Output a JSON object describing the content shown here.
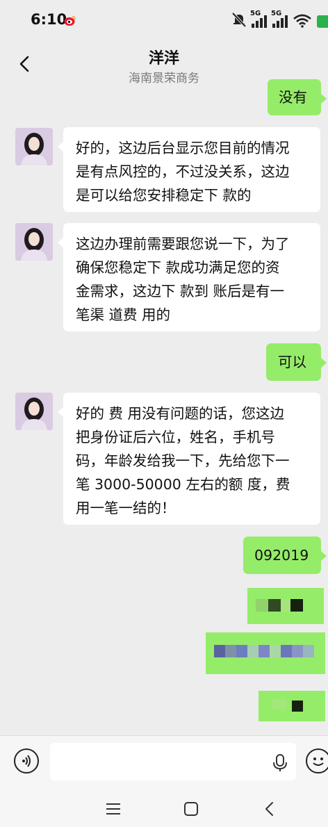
{
  "status": {
    "time": "6:10",
    "sim1_label": "5G",
    "sim2_label": "5G"
  },
  "header": {
    "title": "洋洋",
    "subtitle": "海南景荣商务"
  },
  "messages": [
    {
      "side": "out",
      "text": "没有"
    },
    {
      "side": "in",
      "lines": [
        "好的，这边后台显示您目前的情况",
        "是有点风控的，不过没关系，这边",
        "是可以给您安排稳定下 款的"
      ]
    },
    {
      "side": "in",
      "lines": [
        "这边办理前需要跟您说一下，为了",
        "确保您稳定下 款成功满足您的资",
        "金需求，这边下 款到 账后是有一",
        "笔渠 道费 用的"
      ]
    },
    {
      "side": "out",
      "text": "可以"
    },
    {
      "side": "in",
      "lines": [
        "好的 费 用没有问题的话，您这边",
        "把身份证后六位，姓名，手机号",
        "码，年龄发给我一下，先给您下一",
        "笔 3000-50000 左右的额 度，费",
        "用一笔一结的！"
      ]
    },
    {
      "side": "out",
      "text": "092019"
    },
    {
      "side": "out",
      "text": "",
      "redacted": true
    },
    {
      "side": "out",
      "text": "",
      "redacted": true
    },
    {
      "side": "out",
      "text": "",
      "redacted": true
    }
  ],
  "colors": {
    "outgoing_bubble": "#95ec69",
    "incoming_bubble": "#ffffff",
    "background": "#ededed"
  },
  "icons": {
    "back": "chevron-left-icon",
    "voice": "voice-icon",
    "mic": "microphone-icon",
    "emoji": "emoji-icon",
    "weibo": "weibo-icon"
  }
}
